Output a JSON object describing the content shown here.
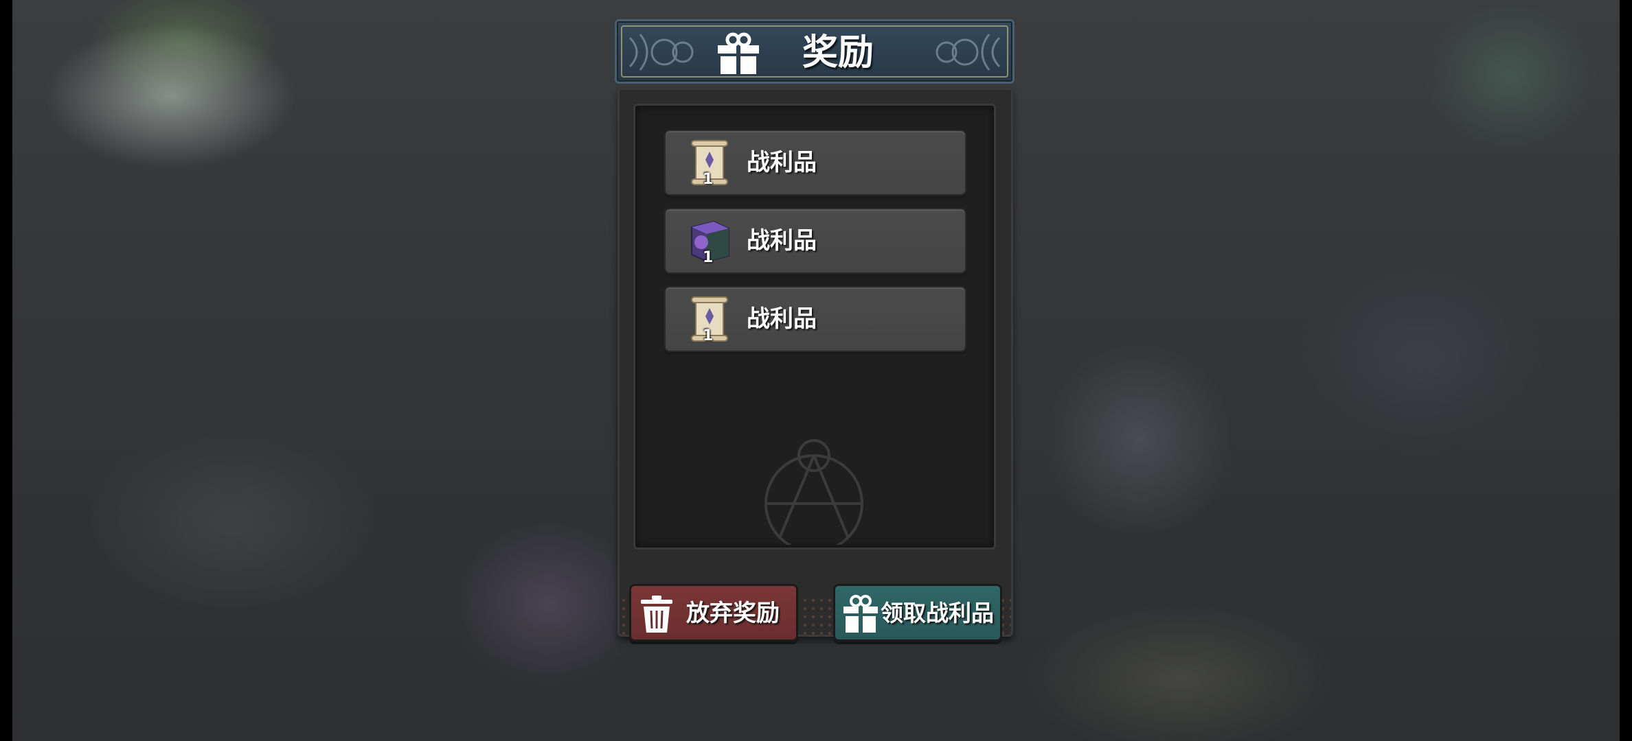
{
  "dialog": {
    "title": "奖励",
    "title_icon": "gift-icon",
    "rewards": [
      {
        "icon": "scroll-icon",
        "quantity": "1",
        "label": "战利品"
      },
      {
        "icon": "purple-chest-icon",
        "quantity": "1",
        "label": "战利品"
      },
      {
        "icon": "scroll-icon",
        "quantity": "1",
        "label": "战利品"
      }
    ],
    "buttons": {
      "discard": {
        "label": "放弃奖励",
        "icon": "trash-icon",
        "color": "#7a3636"
      },
      "claim": {
        "label": "领取战利品",
        "icon": "gift-icon",
        "color": "#2f6667"
      }
    }
  }
}
